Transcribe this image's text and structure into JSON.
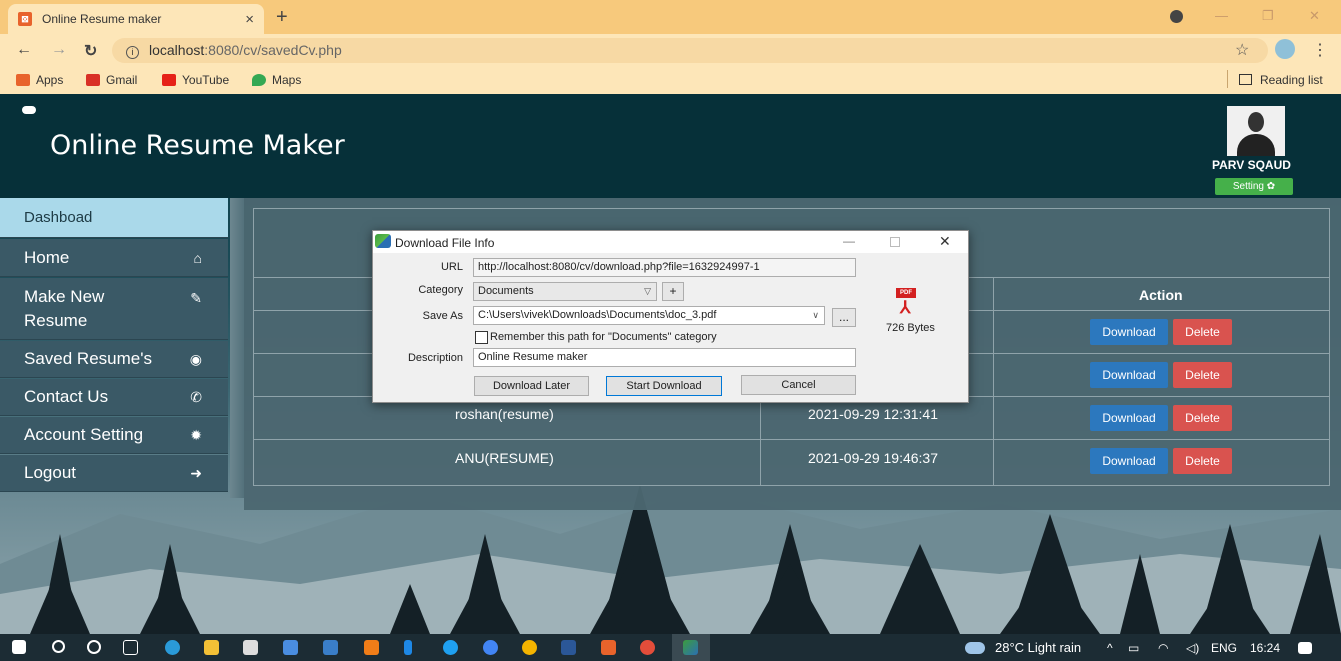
{
  "browser": {
    "tab_title": "Online Resume maker",
    "tab_favicon_glyph": "⊠",
    "tab_close": "×",
    "new_tab": "+",
    "url_host": "localhost",
    "url_path": ":8080/cv/savedCv.php",
    "bookmarks": [
      {
        "label": "Apps",
        "icon": "apps-grid-icon",
        "color": "#e8632b"
      },
      {
        "label": "Gmail",
        "icon": "gmail-icon",
        "color": "#d93025"
      },
      {
        "label": "YouTube",
        "icon": "youtube-icon",
        "color": "#e62117"
      },
      {
        "label": "Maps",
        "icon": "maps-pin-icon",
        "color": "#34a853"
      }
    ],
    "reading_list": "Reading list"
  },
  "header": {
    "site_title": "Online Resume Maker",
    "username": "PARV SQAUD",
    "setting_label": "Setting ✿"
  },
  "sidebar": {
    "items": [
      {
        "label": "Dashboad",
        "icon": ""
      },
      {
        "label": "Home",
        "icon": "home-icon"
      },
      {
        "label": "Make New Resume",
        "icon": "edit-icon"
      },
      {
        "label": "Saved Resume's",
        "icon": "user-circle-icon"
      },
      {
        "label": "Contact Us",
        "icon": "phone-icon"
      },
      {
        "label": "Account Setting",
        "icon": "gear-icon"
      },
      {
        "label": "Logout",
        "icon": "logout-icon"
      }
    ]
  },
  "table": {
    "action_header": "Action",
    "download_label": "Download",
    "delete_label": "Delete",
    "rows": [
      {
        "name": "",
        "date": ""
      },
      {
        "name": "",
        "date": ""
      },
      {
        "name": "roshan(resume)",
        "date": "2021-09-29 12:31:41"
      },
      {
        "name": "ANU(RESUME)",
        "date": "2021-09-29 19:46:37"
      }
    ]
  },
  "dialog": {
    "title": "Download File Info",
    "url_label": "URL",
    "url_value": "http://localhost:8080/cv/download.php?file=1632924997-1",
    "category_label": "Category",
    "category_value": "Documents",
    "add_btn": "+",
    "save_as_label": "Save As",
    "save_as_value": "C:\\Users\\vivek\\Downloads\\Documents\\doc_3.pdf",
    "browse_btn": "...",
    "remember_label": "Remember this path for \"Documents\" category",
    "description_label": "Description",
    "description_value": "Online Resume maker",
    "file_size": "726  Bytes",
    "btn_later": "Download Later",
    "btn_start": "Start Download",
    "btn_cancel": "Cancel"
  },
  "taskbar": {
    "weather": "28°C  Light rain",
    "lang": "ENG",
    "time": "16:24"
  }
}
